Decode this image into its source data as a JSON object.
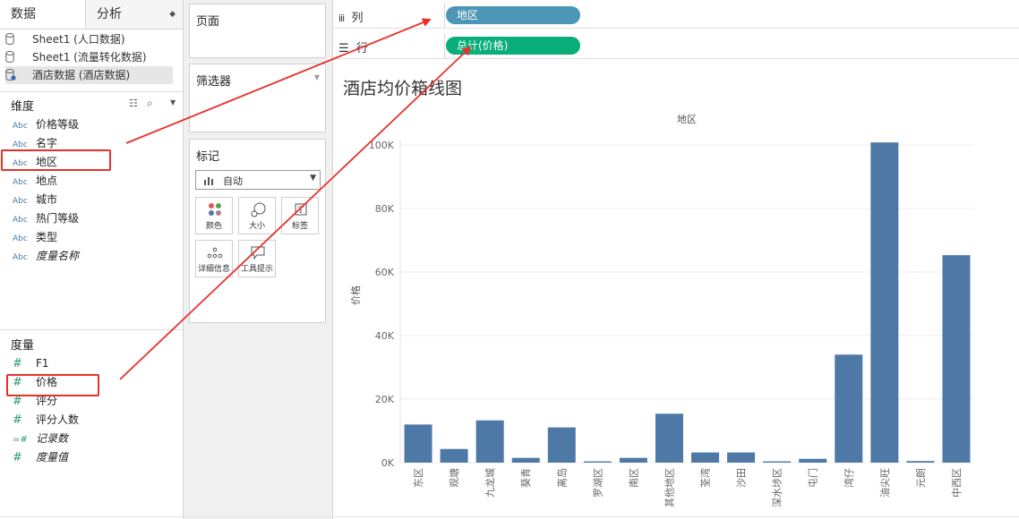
{
  "left": {
    "tabs": [
      {
        "label": "数据"
      },
      {
        "label": "分析"
      }
    ],
    "datasources": [
      {
        "label": "Sheet1 (人口数据)"
      },
      {
        "label": "Sheet1 (流量转化数据)"
      },
      {
        "label": "酒店数据 (酒店数据)"
      }
    ],
    "dimensions_title": "维度",
    "dimensions": [
      {
        "tag": "Abc",
        "label": "价格等级"
      },
      {
        "tag": "Abc",
        "label": "名字"
      },
      {
        "tag": "Abc",
        "label": "地区"
      },
      {
        "tag": "Abc",
        "label": "地点"
      },
      {
        "tag": "Abc",
        "label": "城市"
      },
      {
        "tag": "Abc",
        "label": "热门等级"
      },
      {
        "tag": "Abc",
        "label": "类型"
      },
      {
        "tag": "Abc",
        "label": "度量名称"
      }
    ],
    "measures_title": "度量",
    "measures": [
      {
        "tag": "#",
        "label": "F1"
      },
      {
        "tag": "#",
        "label": "价格"
      },
      {
        "tag": "#",
        "label": "评分"
      },
      {
        "tag": "#",
        "label": "评分人数"
      },
      {
        "tag": "=#",
        "label": "记录数"
      },
      {
        "tag": "#",
        "label": "度量值"
      }
    ]
  },
  "middle": {
    "pages_title": "页面",
    "filters_title": "筛选器",
    "marks_title": "标记",
    "mark_type": "自动",
    "mark_buttons": [
      {
        "label": "颜色",
        "icon": "color-dots-icon"
      },
      {
        "label": "大小",
        "icon": "size-icon"
      },
      {
        "label": "标签",
        "icon": "label-icon"
      },
      {
        "label": "详细信息",
        "icon": "detail-icon"
      },
      {
        "label": "工具提示",
        "icon": "tooltip-icon"
      }
    ]
  },
  "shelves": {
    "columns_label": "列",
    "rows_label": "行",
    "column_pill": "地区",
    "row_pill": "总计(价格)"
  },
  "colors": {
    "bar": "#4e79a7",
    "pill_dimension": "#4c96b6",
    "pill_measure": "#0aae79",
    "highlight": "#e8302a"
  },
  "chart_data": {
    "type": "bar",
    "title": "酒店均价箱线图",
    "header": "地区",
    "ylabel": "价格",
    "ylim": [
      0,
      100000
    ],
    "yticks": [
      "0K",
      "20K",
      "40K",
      "60K",
      "80K",
      "100K"
    ],
    "categories": [
      "东区",
      "观塘",
      "九龙城",
      "葵青",
      "离岛",
      "罗湖区",
      "南区",
      "其他地区",
      "荃湾",
      "沙田",
      "深水埗区",
      "屯门",
      "湾仔",
      "油尖旺",
      "元朗",
      "中西区"
    ],
    "values": [
      12000,
      4300,
      13300,
      1500,
      11100,
      400,
      1500,
      15400,
      3200,
      3200,
      400,
      1200,
      34000,
      100800,
      500,
      65300
    ]
  }
}
